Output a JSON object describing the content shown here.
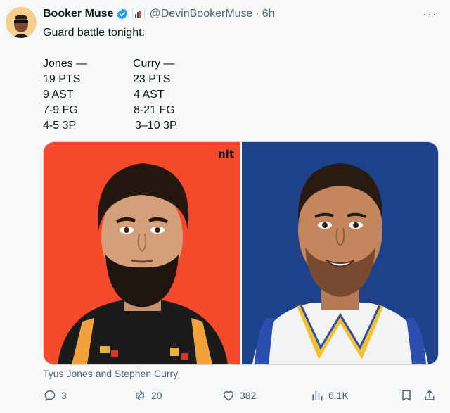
{
  "tweet": {
    "author_name": "Booker Muse",
    "handle": "@DevinBookerMuse",
    "separator": "·",
    "time": "6h",
    "more": "···",
    "text": "Guard battle tonight:",
    "players": [
      {
        "header": "Jones —",
        "lines": [
          "19 PTS",
          "9 AST",
          "7-9 FG",
          "4-5 3P"
        ]
      },
      {
        "header": "Curry —",
        "lines": [
          "23 PTS",
          "4 AST",
          "8-21 FG",
          "3–10 3P"
        ]
      }
    ],
    "media": {
      "left_tag": "nlt",
      "left_bg": "#f4492b",
      "right_bg": "#1d428a"
    },
    "caption": "Tyus Jones and Stephen Curry",
    "actions": {
      "replies": "3",
      "reposts": "20",
      "likes": "382",
      "views": "6.1K"
    }
  },
  "colors": {
    "verified": "#1d9bf0",
    "secondary_text": "#536471",
    "repost_icon": "#536471"
  },
  "icons": [
    "verified-badge-icon",
    "affiliation-icon",
    "more-icon",
    "reply-icon",
    "repost-icon",
    "like-icon",
    "views-icon",
    "bookmark-icon",
    "share-icon"
  ]
}
